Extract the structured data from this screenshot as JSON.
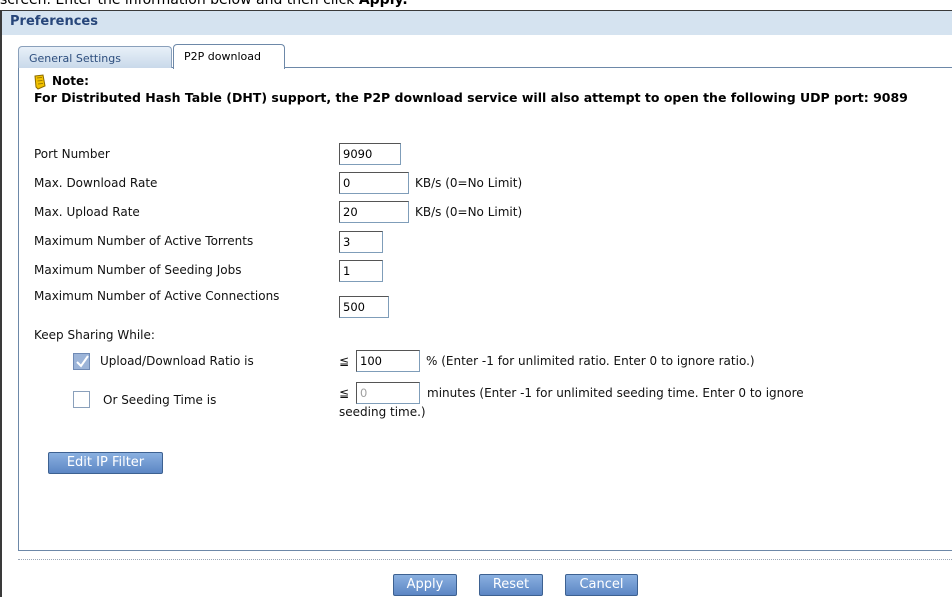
{
  "caption": {
    "prefix": "screen. Enter the information below and then click ",
    "bold": "Apply."
  },
  "window": {
    "title": "Preferences"
  },
  "tabs": [
    {
      "label": "General Settings",
      "active": false
    },
    {
      "label": "P2P download",
      "active": true
    }
  ],
  "note": {
    "icon": "note-icon",
    "label": "Note:",
    "text": "For Distributed Hash Table (DHT) support, the P2P download  service will also attempt to open the following UDP port: 9089"
  },
  "fields": {
    "port_number": {
      "label": "Port Number",
      "value": "9090"
    },
    "max_download_rate": {
      "label": "Max. Download Rate",
      "value": "0",
      "unit": "KB/s (0=No Limit)"
    },
    "max_upload_rate": {
      "label": "Max. Upload Rate",
      "value": "20",
      "unit": "KB/s (0=No Limit)"
    },
    "max_active_torrents": {
      "label": "Maximum Number of Active Torrents",
      "value": "3"
    },
    "max_seeding_jobs": {
      "label": "Maximum Number of Seeding Jobs",
      "value": "1"
    },
    "max_active_connections": {
      "label": "Maximum Number of Active Connections",
      "value": "500"
    }
  },
  "keep_sharing": {
    "label": "Keep Sharing While:",
    "ratio": {
      "label": "Upload/Download Ratio is",
      "checked": true,
      "symbol": "≦",
      "value": "100",
      "unit": "% (Enter -1 for unlimited ratio. Enter 0 to ignore ratio.)"
    },
    "seeding_time": {
      "label": "Or Seeding Time is",
      "checked": false,
      "symbol": "≦",
      "value": "0",
      "unit_line1": "minutes (Enter -1 for unlimited seeding time. Enter 0 to ignore",
      "unit_line2": "seeding time.)"
    }
  },
  "buttons": {
    "edit_ip_filter": "Edit IP Filter",
    "apply": "Apply",
    "reset": "Reset",
    "cancel": "Cancel"
  },
  "colors": {
    "title_bar": "#d5e3f0",
    "title_text": "#27467a",
    "button": "#6b93cc",
    "checkbox_checked": "#9cb4d8"
  }
}
